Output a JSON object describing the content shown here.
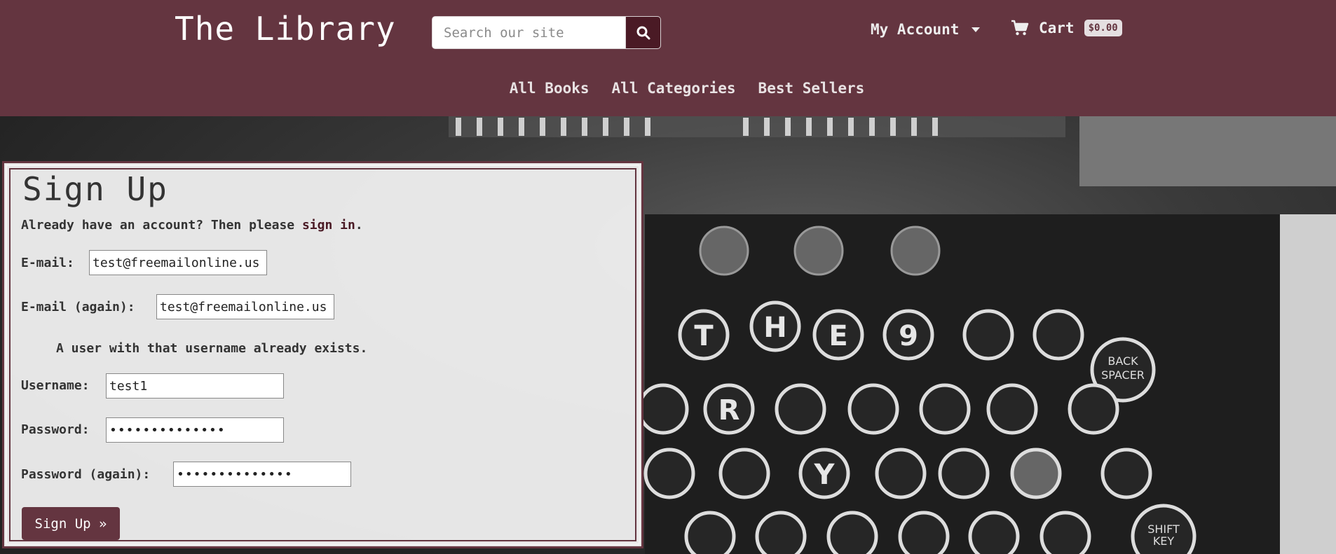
{
  "header": {
    "brand": "The Library",
    "search_placeholder": "Search our site",
    "account_label": "My Account",
    "cart_label": "Cart",
    "cart_total": "$0.00",
    "nav": [
      "All Books",
      "All Categories",
      "Best Sellers"
    ]
  },
  "form": {
    "title": "Sign Up",
    "signin_prefix": "Already have an account? Then please ",
    "signin_link": "sign in",
    "signin_suffix": ".",
    "email_label": "E-mail:",
    "email_value": "test@freemailonline.us",
    "email_again_label": "E-mail (again):",
    "email_again_value": "test@freemailonline.us",
    "error_message": "A user with that username already exists.",
    "username_label": "Username:",
    "username_value": "test1",
    "password_label": "Password:",
    "password_value": "••••••••••••••",
    "password_again_label": "Password (again):",
    "password_again_value": "••••••••••••••",
    "submit_label": "Sign Up »"
  },
  "colors": {
    "brand": "#643540",
    "brand_dark": "#4a1a25"
  }
}
